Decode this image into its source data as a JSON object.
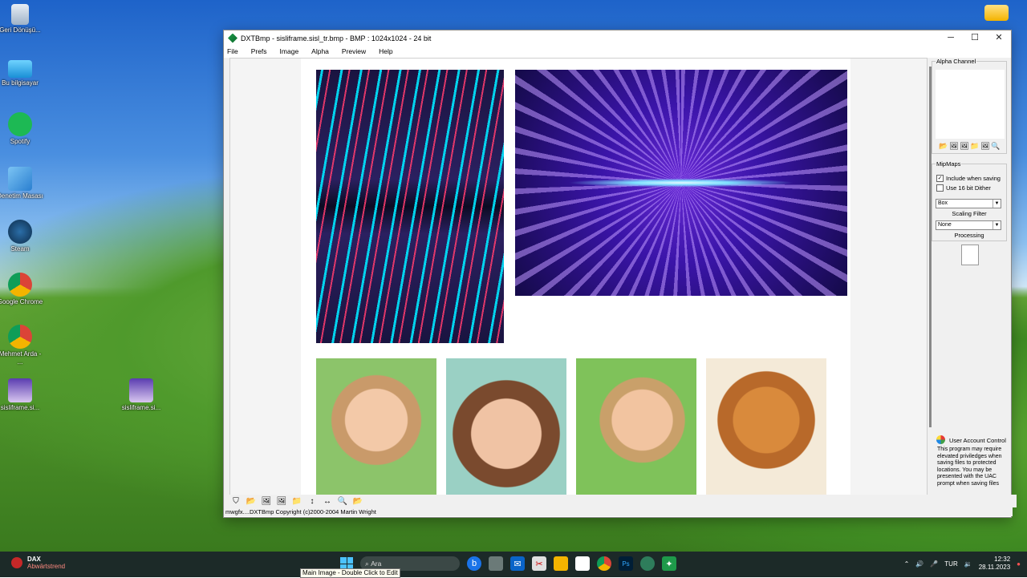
{
  "desktop": {
    "icons": [
      {
        "label": "Geri Dönüşü..."
      },
      {
        "label": "Bu bilgisayar"
      },
      {
        "label": "Spotify"
      },
      {
        "label": "Denetim Masası"
      },
      {
        "label": "Steam"
      },
      {
        "label": "Google Chrome"
      },
      {
        "label": "Mehmet Arda - ..."
      },
      {
        "label": "sisliframe.si..."
      },
      {
        "label": "sisliframe.si..."
      }
    ]
  },
  "window": {
    "title": "DXTBmp - sisliframe.sisl_tr.bmp - BMP : 1024x1024 - 24 bit",
    "minimize": "─",
    "maximize": "☐",
    "close": "✕",
    "menu": [
      "File",
      "Prefs",
      "Image",
      "Alpha",
      "Preview",
      "Help"
    ]
  },
  "panel": {
    "alpha_channel_title": "Alpha Channel",
    "mipmaps_title": "MipMaps",
    "include_when_saving": "Include when saving",
    "include_checked": "✓",
    "use_16bit_dither": "Use 16 bit Dither",
    "filter_value": "Box",
    "scaling_filter_label": "Scaling Filter",
    "processing_value": "None",
    "processing_label": "Processing",
    "uac_title": "User Account Control",
    "uac_text": "This program may require elevated priviledges when saving files to protected locations. You may be presented with the UAC prompt when saving files"
  },
  "status_bar": "mwgfx....DXTBmp Copyright (c)2000-2004 Martin Wright",
  "taskbar": {
    "widget_title": "DAX",
    "widget_sub": "Abwärtstrend",
    "search_placeholder": "Ara",
    "tooltip": "Main Image - Double Click to Edit",
    "language": "TUR",
    "time": "12:32",
    "date": "28.11.2023"
  },
  "colors": {
    "taskbar_bg": "#1c2a28",
    "accent": "#4cc2ff"
  }
}
